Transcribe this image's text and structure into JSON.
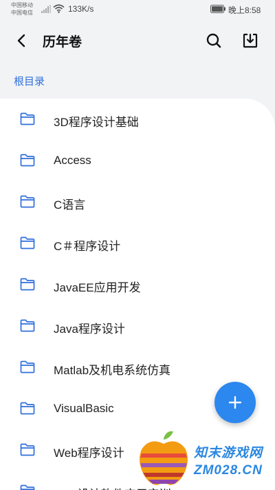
{
  "status_bar": {
    "carrier_1": "中国移动",
    "carrier_2": "中国电信",
    "net_speed": "133K/s",
    "time": "晚上8:58"
  },
  "header": {
    "title": "历年卷"
  },
  "breadcrumb": {
    "label": "根目录"
  },
  "folders": [
    {
      "label": "3D程序设计基础"
    },
    {
      "label": "Access"
    },
    {
      "label": "C语言"
    },
    {
      "label": "C＃程序设计"
    },
    {
      "label": "JavaEE应用开发"
    },
    {
      "label": "Java程序设计"
    },
    {
      "label": "Matlab及机电系统仿真"
    },
    {
      "label": "VisualBasic"
    },
    {
      "label": "Web程序设计"
    },
    {
      "label": "Web设计软件应用实训"
    }
  ],
  "watermark": {
    "text_cn": "知末游戏网",
    "text_en": "ZM028.CN"
  },
  "colors": {
    "accent": "#2f6fdb",
    "fab": "#2c87ef",
    "folder_icon": "#2f6fdb"
  }
}
